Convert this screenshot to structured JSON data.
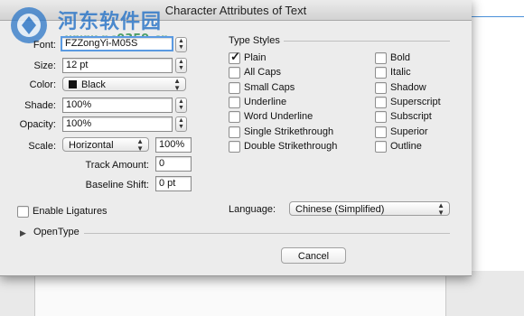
{
  "window": {
    "title": "Character Attributes of Text"
  },
  "watermark": {
    "title": "河东软件园",
    "url": "www.pc0359.cn"
  },
  "left": {
    "font": {
      "label": "Font:",
      "value": "FZZongYi-M05S"
    },
    "size": {
      "label": "Size:",
      "value": "12 pt"
    },
    "color": {
      "label": "Color:",
      "value": "Black",
      "swatch": "#111111"
    },
    "shade": {
      "label": "Shade:",
      "value": "100%"
    },
    "opacity": {
      "label": "Opacity:",
      "value": "100%"
    },
    "scale": {
      "label": "Scale:",
      "mode": "Horizontal",
      "value": "100%"
    },
    "track": {
      "label": "Track Amount:",
      "value": "0"
    },
    "baseline": {
      "label": "Baseline Shift:",
      "value": "0 pt"
    },
    "ligatures": {
      "label": "Enable Ligatures",
      "checked": false
    }
  },
  "type_styles": {
    "heading": "Type Styles",
    "col1": [
      {
        "label": "Plain",
        "checked": true
      },
      {
        "label": "All Caps",
        "checked": false
      },
      {
        "label": "Small Caps",
        "checked": false
      },
      {
        "label": "Underline",
        "checked": false
      },
      {
        "label": "Word Underline",
        "checked": false
      },
      {
        "label": "Single Strikethrough",
        "checked": false
      },
      {
        "label": "Double Strikethrough",
        "checked": false
      }
    ],
    "col2": [
      {
        "label": "Bold",
        "checked": false
      },
      {
        "label": "Italic",
        "checked": false
      },
      {
        "label": "Shadow",
        "checked": false
      },
      {
        "label": "Superscript",
        "checked": false
      },
      {
        "label": "Subscript",
        "checked": false
      },
      {
        "label": "Superior",
        "checked": false
      },
      {
        "label": "Outline",
        "checked": false
      }
    ]
  },
  "language": {
    "label": "Language:",
    "value": "Chinese (Simplified)"
  },
  "opentype": {
    "label": "OpenType"
  },
  "buttons": {
    "cancel": "Cancel"
  }
}
